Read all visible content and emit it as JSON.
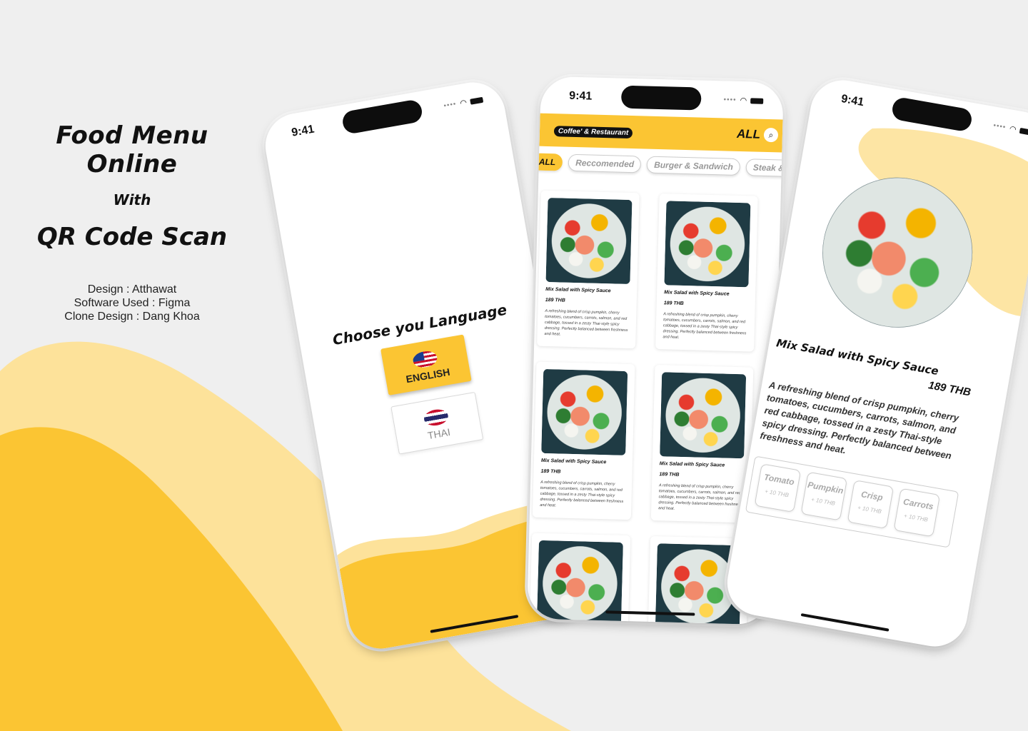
{
  "intro": {
    "title_line1": "Food Menu Online",
    "title_line2": "With",
    "title_line3": "QR Code Scan",
    "credit_design": "Design : Atthawat",
    "credit_software": "Software Used : Figma",
    "credit_clone": "Clone Design : Dang Khoa"
  },
  "colors": {
    "accent": "#fbc533",
    "accent_light": "#fde29a",
    "background": "#efefef",
    "text": "#111111"
  },
  "phones": {
    "language": {
      "time": "9:41",
      "heading": "Choose you Language",
      "english_label": "ENGLISH",
      "english_icon": "us-flag-icon",
      "thai_label": "THAI",
      "thai_icon": "thai-flag-icon"
    },
    "menu": {
      "time": "9:41",
      "brand": "Coffee' & Restaurant",
      "category_label": "ALL",
      "search_icon": "search-icon",
      "chips": [
        "ALL",
        "Reccomended",
        "Burger & Sandwich",
        "Steak & F"
      ],
      "cards": [
        {
          "title": "Mix Salad with Spicy Sauce",
          "price": "189 THB",
          "desc": "A refreshing blend of crisp pumpkin, cherry tomatoes, cucumbers, carrots, salmon, and red cabbage, tossed in a zesty Thai-style spicy dressing. Perfectly balanced between freshness and heat."
        },
        {
          "title": "Mix Salad with Spicy Sauce",
          "price": "189 THB",
          "desc": "A refreshing blend of crisp pumpkin, cherry tomatoes, cucumbers, carrots, salmon, and red cabbage, tossed in a zesty Thai-style spicy dressing. Perfectly balanced between freshness and heat."
        },
        {
          "title": "Mix Salad with Spicy Sauce",
          "price": "189 THB",
          "desc": "A refreshing blend of crisp pumpkin, cherry tomatoes, cucumbers, carrots, salmon, and red cabbage, tossed in a zesty Thai-style spicy dressing. Perfectly balanced between freshness and heat."
        },
        {
          "title": "Mix Salad with Spicy Sauce",
          "price": "189 THB",
          "desc": "A refreshing blend of crisp pumpkin, cherry tomatoes, cucumbers, carrots, salmon, and red cabbage, tossed in a zesty Thai-style spicy dressing. Perfectly balanced between freshness and heat."
        }
      ]
    },
    "detail": {
      "time": "9:41",
      "title": "Mix Salad with Spicy Sauce",
      "price": "189 THB",
      "desc": "A refreshing blend of crisp pumpkin, cherry tomatoes, cucumbers, carrots, salmon, and red cabbage, tossed in a zesty Thai-style spicy dressing. Perfectly balanced between freshness and heat.",
      "addons": [
        {
          "name": "Tomato",
          "price": "+ 10 THB"
        },
        {
          "name": "Pumpkin",
          "price": "+ 10 THB"
        },
        {
          "name": "Crisp",
          "price": "+ 10 THB"
        },
        {
          "name": "Carrots",
          "price": "+ 10 THB"
        }
      ]
    }
  }
}
